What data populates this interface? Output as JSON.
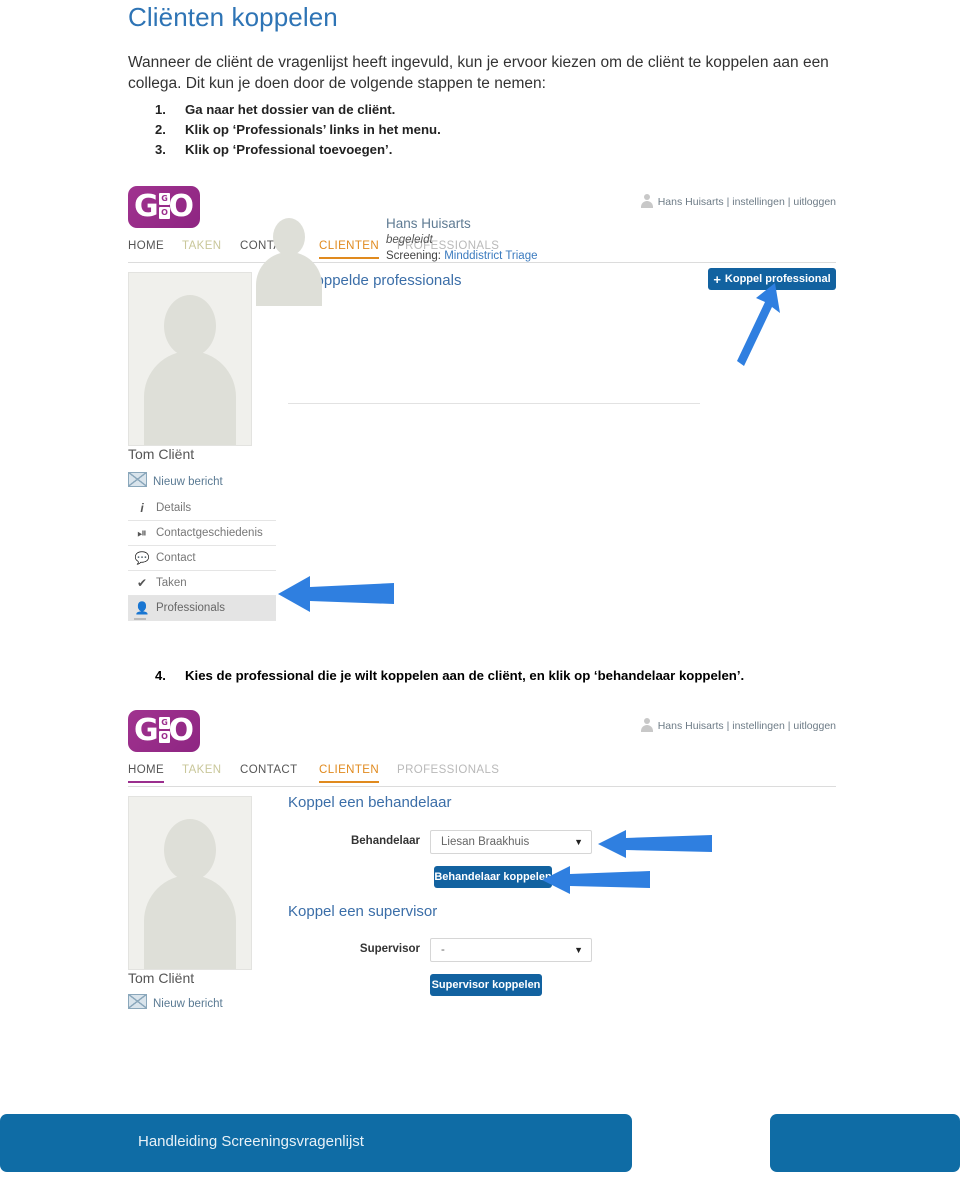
{
  "document": {
    "title": "Cliënten koppelen",
    "intro": "Wanneer de cliënt de vragenlijst heeft ingevuld, kun je ervoor kiezen om de cliënt te koppelen aan een collega. Dit kun je doen door de volgende stappen te nemen:",
    "steps": [
      {
        "num": "1.",
        "text": "Ga naar het dossier van de cliënt."
      },
      {
        "num": "2.",
        "text": "Klik op ‘Professionals’ links in het menu."
      },
      {
        "num": "3.",
        "text": "Klik op ‘Professional toevoegen’."
      }
    ],
    "step4": {
      "num": "4.",
      "text": "Kies de professional die je wilt koppelen aan de cliënt, en klik op ‘behandelaar koppelen’."
    }
  },
  "app": {
    "logo": {
      "left_letter": "G",
      "right_letter": "O",
      "mid_top": "G",
      "mid_bottom": "O"
    },
    "userbar": {
      "name": "Hans Huisarts",
      "sep1": "|",
      "settings": "instellingen",
      "sep2": "|",
      "logout": "uitloggen"
    },
    "nav": [
      {
        "label": "HOME"
      },
      {
        "label": "TAKEN"
      },
      {
        "label": "CONTACT"
      },
      {
        "label": "CLIENTEN"
      },
      {
        "label": "PROFESSIONALS"
      }
    ],
    "client": {
      "name": "Tom Cliënt",
      "new_message": "Nieuw bericht"
    },
    "menu": [
      {
        "label": "Details",
        "icon": "info-icon"
      },
      {
        "label": "Contactgeschiedenis",
        "icon": "clock-icon"
      },
      {
        "label": "Contact",
        "icon": "chat-icon"
      },
      {
        "label": "Taken",
        "icon": "check-icon"
      },
      {
        "label": "Professionals",
        "icon": "person-icon"
      }
    ]
  },
  "screen1": {
    "heading": "Gekoppelde professionals",
    "add_button": "Koppel professional",
    "professional": {
      "name": "Hans Huisarts",
      "role": "begeleidt",
      "screening_label": "Screening:",
      "screening_value": "Minddistrict Triage"
    }
  },
  "screen2": {
    "heading_behandelaar": "Koppel een behandelaar",
    "label_behandelaar": "Behandelaar",
    "select_behandelaar": "Liesan Braakhuis",
    "button_behandelaar": "Behandelaar koppelen",
    "heading_supervisor": "Koppel een supervisor",
    "label_supervisor": "Supervisor",
    "select_supervisor": "-",
    "button_supervisor": "Supervisor koppelen"
  },
  "footer": {
    "label": "Handleiding Screeningsvragenlijst"
  },
  "colors": {
    "heading_blue": "#2e74b5",
    "brand_purple": "#9b2e8e",
    "nav_active_orange": "#e08a1e",
    "button_blue": "#1262a0",
    "arrow_blue": "#2f7fe0",
    "footer_blue": "#0f6ca5"
  }
}
